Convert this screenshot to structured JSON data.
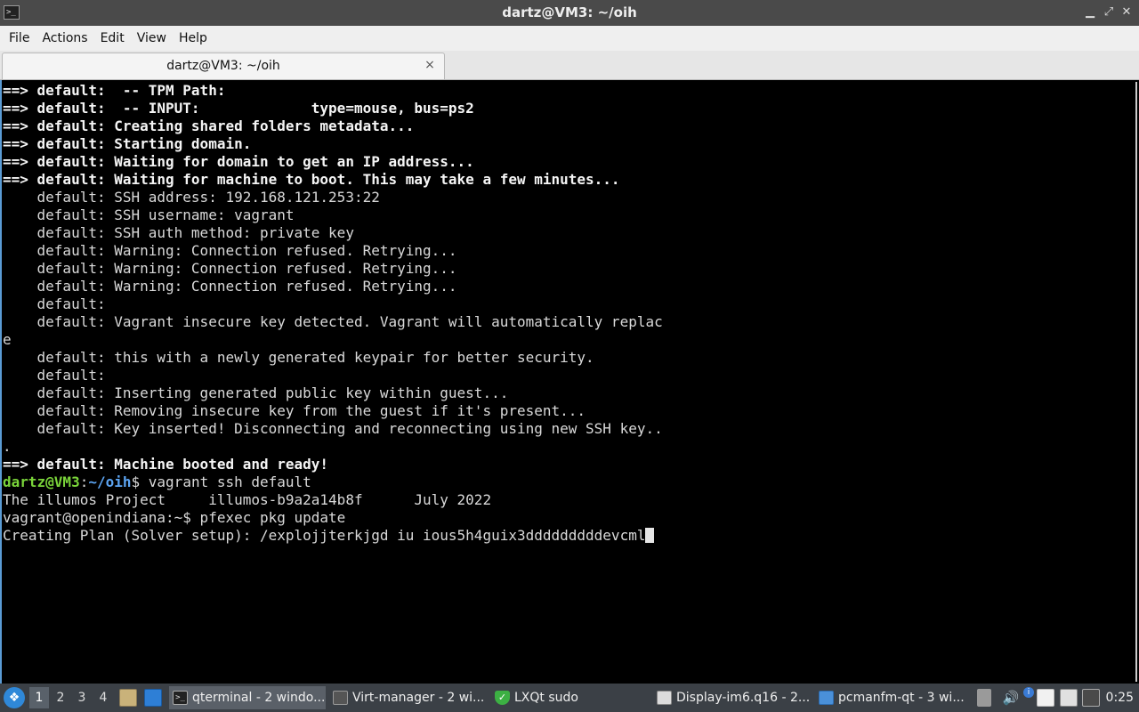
{
  "window": {
    "title": "dartz@VM3: ~/oih",
    "app_icon": "terminal-icon",
    "controls": [
      "minimize-icon",
      "maximize-icon",
      "close-icon"
    ]
  },
  "menu": [
    "File",
    "Actions",
    "Edit",
    "View",
    "Help"
  ],
  "tab": {
    "label": "dartz@VM3: ~/oih",
    "close": "×"
  },
  "terminal": {
    "lines": [
      "==> default:  -- TPM Path:",
      "==> default:  -- INPUT:             type=mouse, bus=ps2",
      "==> default: Creating shared folders metadata...",
      "==> default: Starting domain.",
      "==> default: Waiting for domain to get an IP address...",
      "==> default: Waiting for machine to boot. This may take a few minutes...",
      "    default: SSH address: 192.168.121.253:22",
      "    default: SSH username: vagrant",
      "    default: SSH auth method: private key",
      "    default: Warning: Connection refused. Retrying...",
      "    default: Warning: Connection refused. Retrying...",
      "    default: Warning: Connection refused. Retrying...",
      "    default:",
      "    default: Vagrant insecure key detected. Vagrant will automatically replac",
      "e",
      "    default: this with a newly generated keypair for better security.",
      "    default:",
      "    default: Inserting generated public key within guest...",
      "    default: Removing insecure key from the guest if it's present...",
      "    default: Key inserted! Disconnecting and reconnecting using new SSH key..",
      ".",
      "==> default: Machine booted and ready!"
    ],
    "prompt_user": "dartz@VM3",
    "prompt_sep": ":",
    "prompt_path": "~/oih",
    "prompt_sign": "$ ",
    "command": "vagrant ssh default",
    "after": [
      "The illumos Project     illumos-b9a2a14b8f      July 2022",
      "vagrant@openindiana:~$ pfexec pkg update"
    ],
    "current_line": "Creating Plan (Solver setup): /explojjterkjgd iu ious5h4guix3dddddddddevcml"
  },
  "taskbar": {
    "start_icon": "lxqt-menu-icon",
    "workspaces": [
      "1",
      "2",
      "3",
      "4"
    ],
    "active_workspace": "1",
    "tasks": [
      {
        "label": "qterminal - 2 windo...",
        "icon": "terminal-icon"
      },
      {
        "label": "Virt-manager - 2 wi...",
        "icon": "virt-manager-icon"
      },
      {
        "label": "LXQt sudo",
        "icon": "shield-icon"
      },
      {
        "label": "Display-im6.q16 - 2...",
        "icon": "image-viewer-icon"
      },
      {
        "label": "pcmanfm-qt - 3 wi...",
        "icon": "folder-icon"
      }
    ],
    "clock": "0:25"
  }
}
